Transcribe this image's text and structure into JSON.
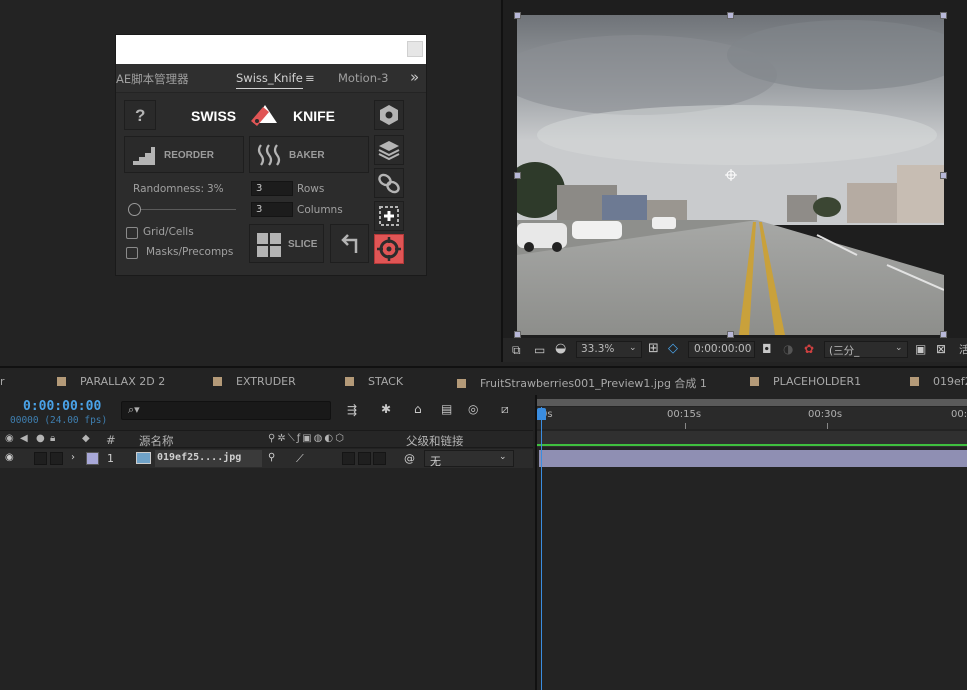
{
  "script_panel": {
    "tabs": [
      {
        "label": "AE脚本管理器"
      },
      {
        "label": "Swiss_Knife"
      },
      {
        "label": "Motion-3"
      }
    ],
    "overflow_glyph": "»",
    "menu_glyph": "≡",
    "title_left": "SWISS",
    "title_right": "KNIFE",
    "help_label": "?",
    "reorder_label": "REORDER",
    "baker_label": "BAKER",
    "slice_label": "SLICE",
    "randomness_label": "Randomness:",
    "randomness_value": "3%",
    "randomness_fraction": 0.0,
    "rows_value": "3",
    "rows_label": "Rows",
    "columns_value": "3",
    "columns_label": "Columns",
    "grid_cells_label": "Grid/Cells",
    "masks_precomps_label": "Masks/Precomps"
  },
  "viewer": {
    "zoom": "33.3%",
    "timecode": "0:00:00:00",
    "resolution": "(三分_",
    "truncated_label": "活"
  },
  "comp_tabs": [
    {
      "label": "PARALLAX 2D 2"
    },
    {
      "label": "EXTRUDER"
    },
    {
      "label": "STACK"
    },
    {
      "label": "FruitStrawberries001_Preview1.jpg 合成 1"
    },
    {
      "label": "PLACEHOLDER1"
    },
    {
      "label": "019ef2"
    }
  ],
  "timeline": {
    "timecode": "0:00:00:00",
    "fps": "00000 (24.00 fps)",
    "search_icon": "⌕▾",
    "columns": {
      "number": "#",
      "source_name": "源名称",
      "parent": "父级和链接"
    },
    "layer": {
      "number": "1",
      "name": "019ef25....jpg",
      "parent_value": "无",
      "label_color": "#a8a8d8"
    },
    "ruler_ticks": [
      "0s",
      "00:15s",
      "00:30s",
      "00:"
    ]
  },
  "colors": {
    "accent_blue": "#4aa3e8",
    "layer_bar": "#8f8fb3",
    "tab_swatch": "#b49a78",
    "target_red": "#e05555"
  }
}
